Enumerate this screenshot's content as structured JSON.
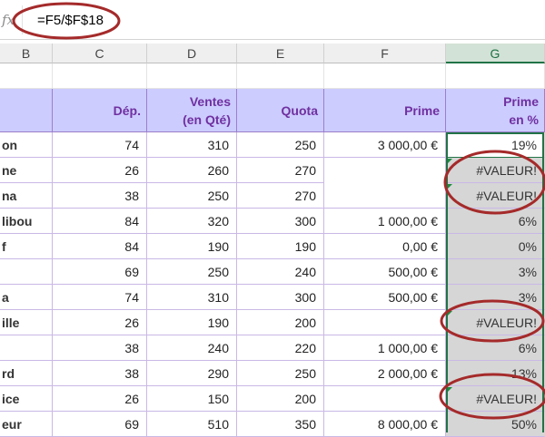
{
  "formula_bar": {
    "fx_label": "fx",
    "formula": "=F5/$F$18"
  },
  "columns": [
    {
      "id": "B",
      "label": "B"
    },
    {
      "id": "C",
      "label": "C"
    },
    {
      "id": "D",
      "label": "D"
    },
    {
      "id": "E",
      "label": "E"
    },
    {
      "id": "F",
      "label": "F"
    },
    {
      "id": "G",
      "label": "G",
      "selected": true
    }
  ],
  "headers": {
    "dep": "Dép.",
    "ventes_1": "Ventes",
    "ventes_2": "(en Qté)",
    "quota": "Quota",
    "prime": "Prime",
    "prime_pct_1": "Prime",
    "prime_pct_2": "en %"
  },
  "rows": [
    {
      "name": "on",
      "dep": "74",
      "ventes": "310",
      "quota": "250",
      "prime": "3 000,00 €",
      "pct": "19%"
    },
    {
      "name": "ne",
      "dep": "26",
      "ventes": "260",
      "quota": "270",
      "prime": "",
      "pct": "#VALEUR!"
    },
    {
      "name": "na",
      "dep": "38",
      "ventes": "250",
      "quota": "270",
      "prime": "",
      "pct": "#VALEUR!"
    },
    {
      "name": "libou",
      "dep": "84",
      "ventes": "320",
      "quota": "300",
      "prime": "1 000,00 €",
      "pct": "6%"
    },
    {
      "name": "f",
      "dep": "84",
      "ventes": "190",
      "quota": "190",
      "prime": "0,00 €",
      "pct": "0%"
    },
    {
      "name": "",
      "dep": "69",
      "ventes": "250",
      "quota": "240",
      "prime": "500,00 €",
      "pct": "3%"
    },
    {
      "name": "a",
      "dep": "74",
      "ventes": "310",
      "quota": "300",
      "prime": "500,00 €",
      "pct": "3%"
    },
    {
      "name": "ille",
      "dep": "26",
      "ventes": "190",
      "quota": "200",
      "prime": "",
      "pct": "#VALEUR!"
    },
    {
      "name": "",
      "dep": "38",
      "ventes": "240",
      "quota": "220",
      "prime": "1 000,00 €",
      "pct": "6%"
    },
    {
      "name": "rd",
      "dep": "38",
      "ventes": "290",
      "quota": "250",
      "prime": "2 000,00 €",
      "pct": "13%"
    },
    {
      "name": "ice",
      "dep": "26",
      "ventes": "150",
      "quota": "200",
      "prime": "",
      "pct": "#VALEUR!"
    },
    {
      "name": "eur",
      "dep": "69",
      "ventes": "510",
      "quota": "350",
      "prime": "8 000,00 €",
      "pct": "50%"
    }
  ],
  "colors": {
    "header_bg": "#ccccff",
    "header_text": "#7030a0",
    "selection": "#217346",
    "annotation": "#a52a2a"
  }
}
